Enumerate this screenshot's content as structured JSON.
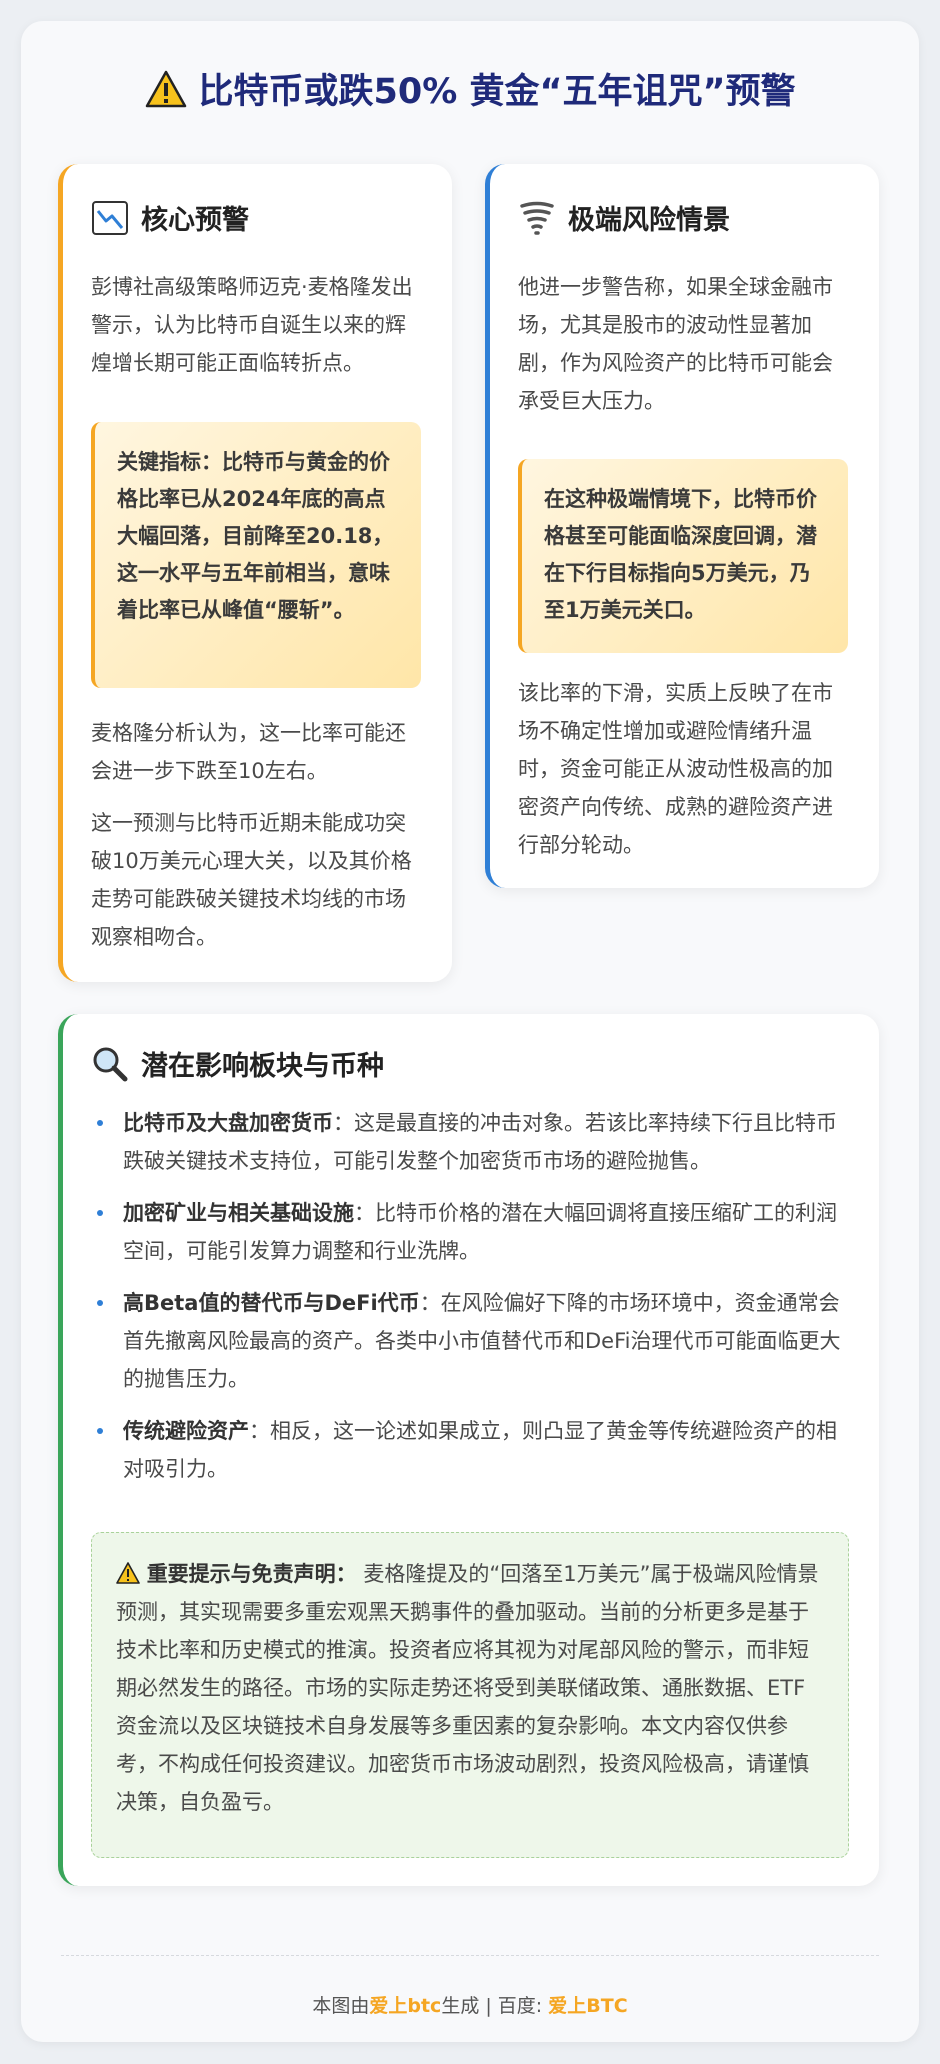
{
  "title": "比特币或跌50% 黄金“五年诅咒”预警",
  "core": {
    "heading": "核心预警",
    "intro": "彭博社高级策略师迈克·麦格隆发出警示，认为比特币自诞生以来的辉煌增长期可能正面临转折点。",
    "highlight": "关键指标：比特币与黄金的价格比率已从2024年底的高点大幅回落，目前降至20.18，这一水平与五年前相当，意味着比率已从峰值“腰斩”。",
    "para2": "麦格隆分析认为，这一比率可能还会进一步下跌至10左右。",
    "para3": "这一预测与比特币近期未能成功突破10万美元心理大关，以及其价格走势可能跌破关键技术均线的市场观察相吻合。"
  },
  "extreme": {
    "heading": "极端风险情景",
    "intro": "他进一步警告称，如果全球金融市场，尤其是股市的波动性显著加剧，作为风险资产的比特币可能会承受巨大压力。",
    "highlight": "在这种极端情境下，比特币价格甚至可能面临深度回调，潜在下行目标指向5万美元，乃至1万美元关口。",
    "para2": "该比率的下滑，实质上反映了在市场不确定性增加或避险情绪升温时，资金可能正从波动性极高的加密资产向传统、成熟的避险资产进行部分轮动。"
  },
  "impact": {
    "heading": "潜在影响板块与币种",
    "items": [
      {
        "term": "比特币及大盘加密货币",
        "desc": "：这是最直接的冲击对象。若该比率持续下行且比特币跌破关键技术支持位，可能引发整个加密货币市场的避险抛售。"
      },
      {
        "term": "加密矿业与相关基础设施",
        "desc": "：比特币价格的潜在大幅回调将直接压缩矿工的利润空间，可能引发算力调整和行业洗牌。"
      },
      {
        "term": "高Beta值的替代币与DeFi代币",
        "desc": "：在风险偏好下降的市场环境中，资金通常会首先撤离风险最高的资产。各类中小市值替代币和DeFi治理代币可能面临更大的抛售压力。"
      },
      {
        "term": "传统避险资产",
        "desc": "：相反，这一论述如果成立，则凸显了黄金等传统避险资产的相对吸引力。"
      }
    ],
    "notice_label": "重要提示与免责声明：",
    "notice_text": "麦格隆提及的“回落至1万美元”属于极端风险情景预测，其实现需要多重宏观黑天鹅事件的叠加驱动。当前的分析更多是基于技术比率和历史模式的推演。投资者应将其视为对尾部风险的警示，而非短期必然发生的路径。市场的实际走势还将受到美联储政策、通胀数据、ETF资金流以及区块链技术自身发展等多重因素的复杂影响。本文内容仅供参考，不构成任何投资建议。加密货币市场波动剧烈，投资风险极高，请谨慎决策，自负盈亏。"
  },
  "footer": {
    "prefix": "本图由",
    "brand1": "爱上btc",
    "middle": "生成 | 百度: ",
    "brand2": "爱上BTC"
  },
  "colors": {
    "orange_accent": "#f5a623",
    "blue_accent": "#2f7fd6",
    "green_accent": "#3aa55a",
    "title_color": "#1f2a7a"
  }
}
